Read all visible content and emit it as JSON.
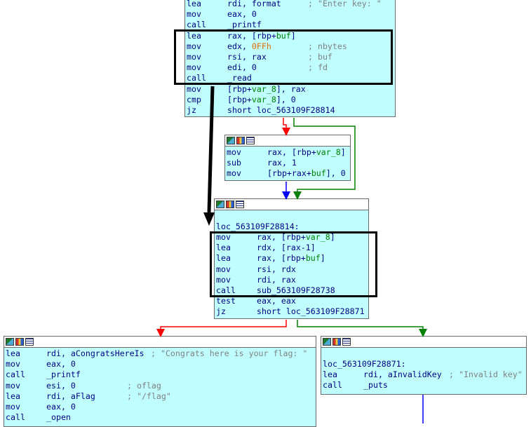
{
  "blocks": {
    "top": {
      "lines": [
        {
          "m": "lea",
          "o": "rdi, format",
          "c": "; \"Enter key: \""
        },
        {
          "m": "mov",
          "o": "eax, 0",
          "c": ""
        },
        {
          "m": "call",
          "o": "_printf",
          "c": ""
        },
        {
          "m": "lea",
          "o": "rax, [rbp+buf]",
          "c": ""
        },
        {
          "m": "mov",
          "o": "edx, 0FFh",
          "c": "; nbytes"
        },
        {
          "m": "mov",
          "o": "rsi, rax",
          "c": "; buf"
        },
        {
          "m": "mov",
          "o": "edi, 0",
          "c": "; fd"
        },
        {
          "m": "call",
          "o": "_read",
          "c": ""
        },
        {
          "m": "mov",
          "o": "[rbp+var_8], rax",
          "c": ""
        },
        {
          "m": "cmp",
          "o": "[rbp+var_8], 0",
          "c": ""
        },
        {
          "m": "jz",
          "o": "short loc_563109F28814",
          "c": ""
        }
      ]
    },
    "middle": {
      "lines": [
        {
          "m": "mov",
          "o": "rax, [rbp+var_8]",
          "c": ""
        },
        {
          "m": "sub",
          "o": "rax, 1",
          "c": ""
        },
        {
          "m": "mov",
          "o": "[rbp+rax+buf], 0",
          "c": ""
        }
      ]
    },
    "loc814": {
      "label": "loc_563109F28814:",
      "lines": [
        {
          "m": "mov",
          "o": "rax, [rbp+var_8]",
          "c": ""
        },
        {
          "m": "lea",
          "o": "rdx, [rax-1]",
          "c": ""
        },
        {
          "m": "lea",
          "o": "rax, [rbp+buf]",
          "c": ""
        },
        {
          "m": "mov",
          "o": "rsi, rdx",
          "c": ""
        },
        {
          "m": "mov",
          "o": "rdi, rax",
          "c": ""
        },
        {
          "m": "call",
          "o": "sub_563109F28738",
          "c": ""
        },
        {
          "m": "test",
          "o": "eax, eax",
          "c": ""
        },
        {
          "m": "jz",
          "o": "short loc_563109F28871",
          "c": ""
        }
      ]
    },
    "congrats": {
      "lines": [
        {
          "m": "lea",
          "o": "rdi, aCongratsHereIs",
          "c": "; \"Congrats here is your flag: \""
        },
        {
          "m": "mov",
          "o": "eax, 0",
          "c": ""
        },
        {
          "m": "call",
          "o": "_printf",
          "c": ""
        },
        {
          "m": "mov",
          "o": "esi, 0",
          "c": "; oflag"
        },
        {
          "m": "lea",
          "o": "rdi, aFlag",
          "c": "; \"/flag\""
        },
        {
          "m": "mov",
          "o": "eax, 0",
          "c": ""
        },
        {
          "m": "call",
          "o": "_open",
          "c": ""
        }
      ]
    },
    "invalid": {
      "label": "loc_563109F28871:",
      "lines": [
        {
          "m": "lea",
          "o": "rdi, aInvalidKey",
          "c": "; \"Invalid key\""
        },
        {
          "m": "call",
          "o": "_puts",
          "c": ""
        }
      ]
    }
  },
  "icons": [
    "graph-icon",
    "color-icon",
    "list-icon"
  ],
  "colors": {
    "block_bg": "#c0ffff",
    "edge_true": "#ff0000",
    "edge_false": "#008000",
    "edge_uncond": "#0000ff",
    "mnemonic": "#000080",
    "variable": "#008000",
    "number": "#e06c00",
    "comment": "#808080"
  }
}
